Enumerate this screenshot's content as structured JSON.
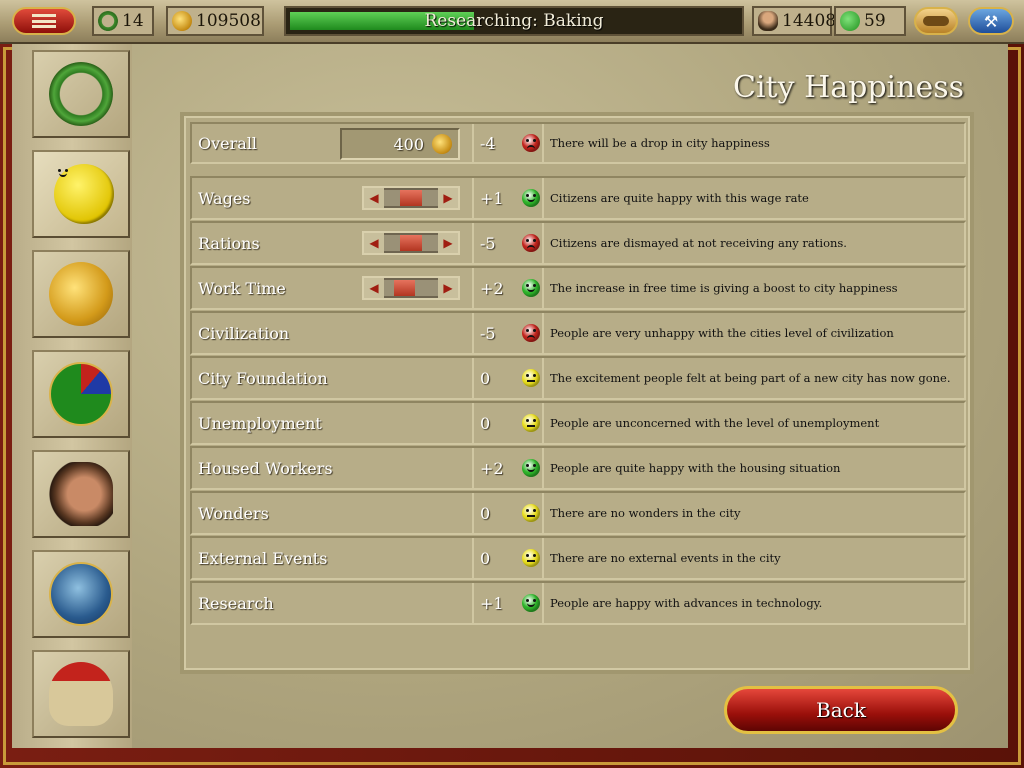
{
  "topbar": {
    "laurel_count": "14",
    "gold": "109508",
    "research_label": "Researching: Baking",
    "research_progress": 0.42,
    "population": "14408",
    "happiness": "59"
  },
  "sidebar": {
    "items": [
      {
        "icon": "laurel-wreath-icon"
      },
      {
        "icon": "happy-face-icon",
        "active": true
      },
      {
        "icon": "gold-coin-icon"
      },
      {
        "icon": "pie-chart-icon"
      },
      {
        "icon": "roman-bust-icon"
      },
      {
        "icon": "globe-icon"
      },
      {
        "icon": "roman-helmet-icon"
      }
    ]
  },
  "page": {
    "title": "City Happiness",
    "back_label": "Back"
  },
  "overall": {
    "label": "Overall",
    "amount": "400",
    "value": "-4",
    "mood": "red",
    "description": "There will be a drop in city happiness"
  },
  "rows": [
    {
      "label": "Wages",
      "value": "+1",
      "mood": "green",
      "slider": 0.5,
      "description": "Citizens are quite happy with this wage rate"
    },
    {
      "label": "Rations",
      "value": "-5",
      "mood": "red",
      "slider": 0.5,
      "description": "Citizens are dismayed at not receiving any rations."
    },
    {
      "label": "Work Time",
      "value": "+2",
      "mood": "green",
      "slider": 0.3,
      "description": "The increase in free time is giving a boost to city happiness"
    },
    {
      "label": "Civilization",
      "value": "-5",
      "mood": "red",
      "description": "People are very unhappy with the cities level of civilization"
    },
    {
      "label": "City Foundation",
      "value": "0",
      "mood": "neutral",
      "description": "The excitement people felt at being part of a new city has now gone."
    },
    {
      "label": "Unemployment",
      "value": "0",
      "mood": "neutral",
      "description": "People are unconcerned with the level of unemployment"
    },
    {
      "label": "Housed Workers",
      "value": "+2",
      "mood": "green",
      "description": "People are quite happy with the housing situation"
    },
    {
      "label": "Wonders",
      "value": "0",
      "mood": "neutral",
      "description": "There are no wonders in the city"
    },
    {
      "label": "External Events",
      "value": "0",
      "mood": "neutral",
      "description": "There are no external events in the city"
    },
    {
      "label": "Research",
      "value": "+1",
      "mood": "green",
      "description": "People are happy with advances in technology."
    }
  ],
  "colors": {
    "mood_green": "#2fb52a",
    "mood_red": "#c3231c",
    "mood_neutral": "#e9de1f"
  }
}
